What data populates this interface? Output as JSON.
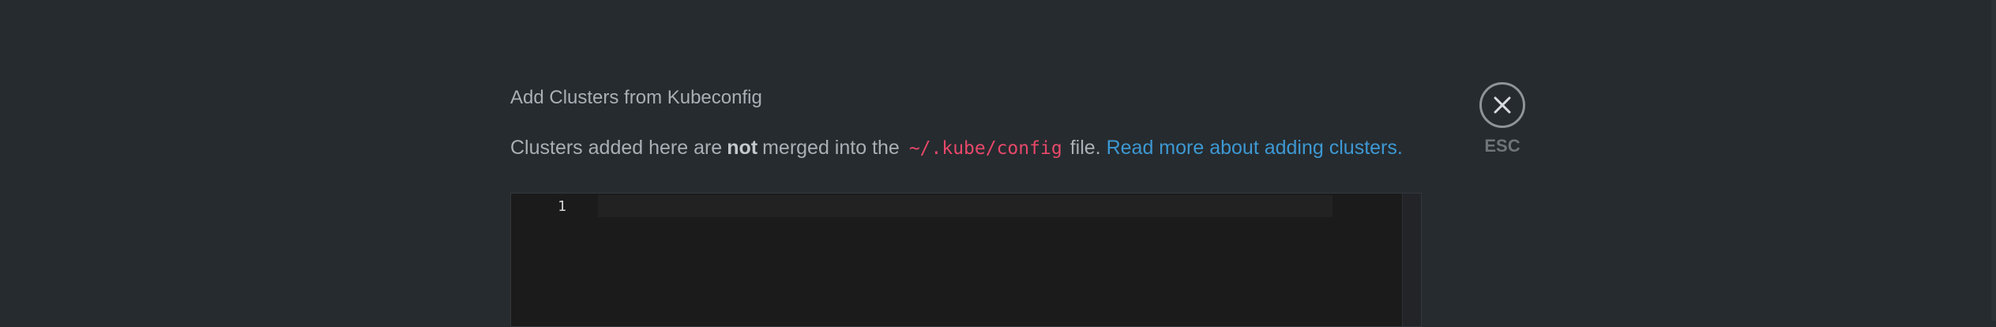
{
  "dialog": {
    "title": "Add Clusters from Kubeconfig",
    "info": {
      "prefix": "Clusters added here are",
      "emphasis": "not",
      "middle": "merged into the",
      "code": "~/.kube/config",
      "suffix": "file.",
      "link_label": "Read more about adding clusters."
    },
    "editor": {
      "line_number": "1",
      "value": ""
    },
    "close": {
      "icon": "close-icon",
      "label": "ESC"
    }
  },
  "colors": {
    "background": "#262b2f",
    "text": "#a9afb5",
    "code": "#e8486a",
    "link": "#3d98d3",
    "editor_bg": "#1b1b1b"
  }
}
